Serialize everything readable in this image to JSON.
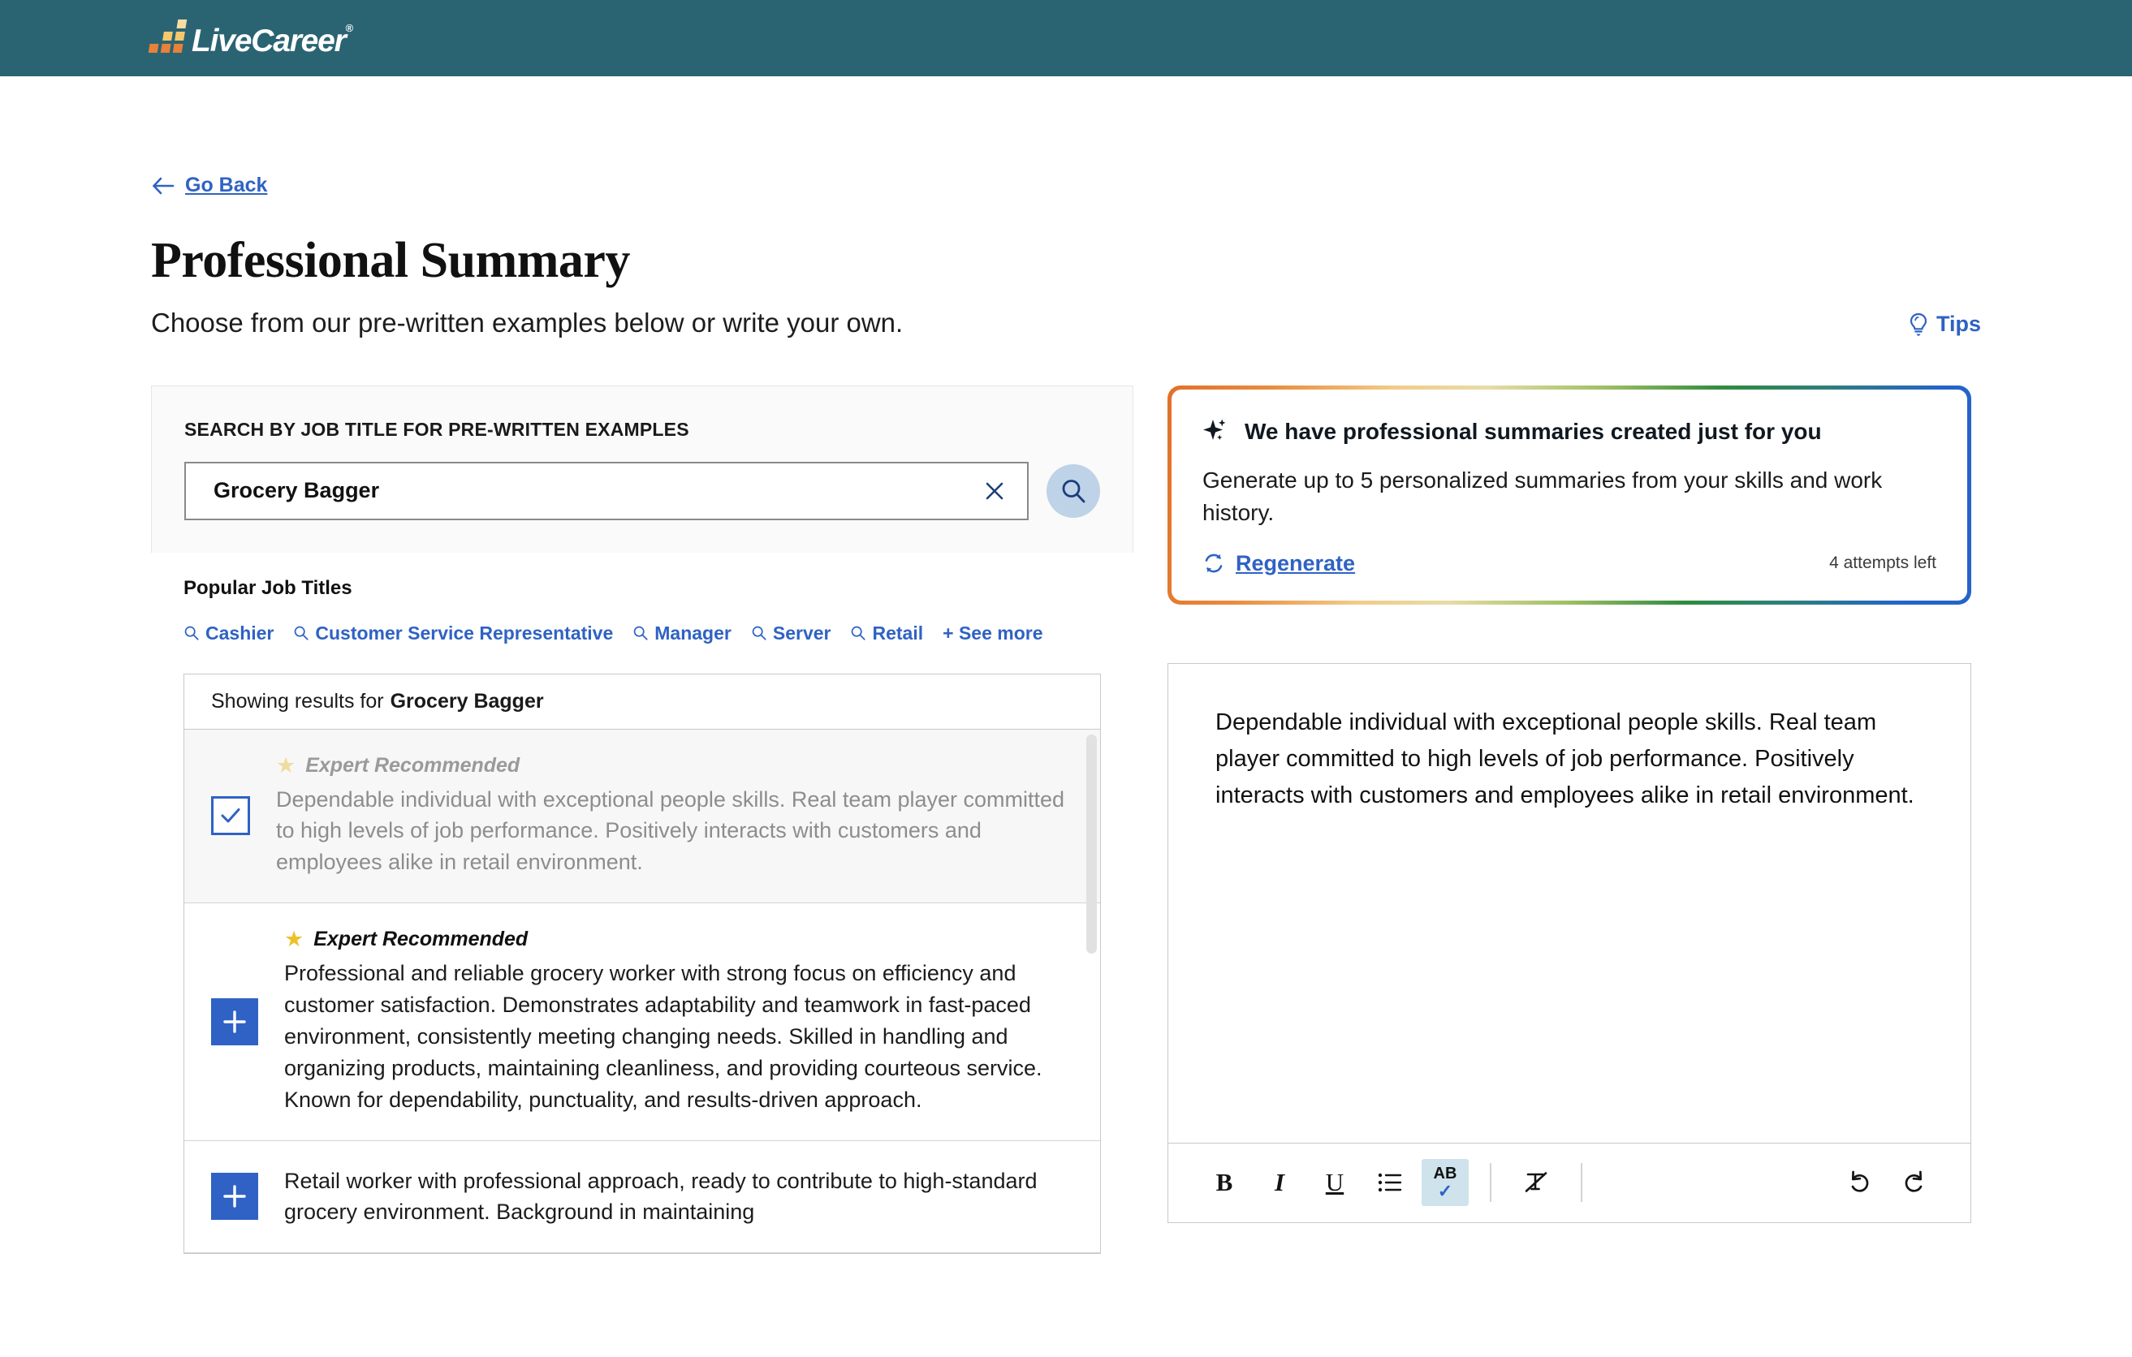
{
  "header": {
    "brand": "LiveCareer",
    "brand_trademark": "®",
    "brand_bg": "#2a6472"
  },
  "nav": {
    "go_back": "Go Back",
    "tips": "Tips"
  },
  "page": {
    "title": "Professional Summary",
    "subtitle": "Choose from our pre-written examples below or write your own."
  },
  "search": {
    "label": "SEARCH BY JOB TITLE FOR PRE-WRITTEN EXAMPLES",
    "value": "Grocery Bagger",
    "placeholder": "Search by job title"
  },
  "popular": {
    "title": "Popular Job Titles",
    "items": [
      {
        "label": "Cashier"
      },
      {
        "label": "Customer Service Representative"
      },
      {
        "label": "Manager"
      },
      {
        "label": "Server"
      },
      {
        "label": "Retail"
      }
    ],
    "see_more": "+ See more"
  },
  "results": {
    "heading_prefix": "Showing results for",
    "heading_query": "Grocery Bagger",
    "items": [
      {
        "badge": "Expert Recommended",
        "state": "selected",
        "action": "check",
        "text": "Dependable individual with exceptional people skills. Real team player committed to high levels of job performance. Positively interacts with customers and employees alike in retail environment."
      },
      {
        "badge": "Expert Recommended",
        "state": "default",
        "action": "add",
        "text": "Professional and reliable grocery worker with strong focus on efficiency and customer satisfaction. Demonstrates adaptability and teamwork in fast-paced environment, consistently meeting changing needs. Skilled in handling and organizing products, maintaining cleanliness, and providing courteous service. Known for dependability, punctuality, and results-driven approach."
      },
      {
        "badge": "",
        "state": "default",
        "action": "add",
        "text": "Retail worker with professional approach, ready to contribute to high-standard grocery environment. Background in maintaining"
      }
    ]
  },
  "ai_card": {
    "title": "We have professional summaries created just for you",
    "description": "Generate up to 5 personalized summaries from your skills and work history.",
    "regenerate": "Regenerate",
    "attempts": "4 attempts left",
    "gradient_colors": [
      "#e2702a",
      "#f2cb8a",
      "#2f8b3e",
      "#2563c9"
    ]
  },
  "editor": {
    "content": "Dependable individual with exceptional people skills. Real team player committed to high levels of job performance. Positively interacts with customers and employees alike in retail environment.",
    "toolbar": {
      "bold": "B",
      "italic": "I",
      "underline": "U",
      "bullet_list": "bullet-list",
      "spellcheck_label": "AB",
      "spellcheck_check": "✓",
      "clear_format": "clear-formatting",
      "undo": "undo",
      "redo": "redo"
    }
  }
}
